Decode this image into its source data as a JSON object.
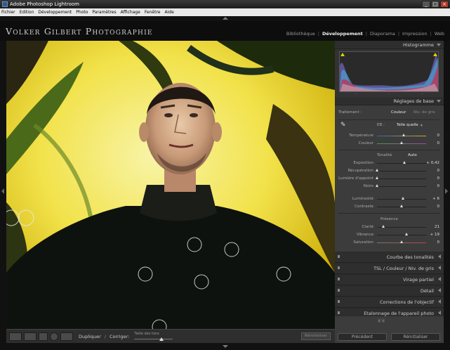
{
  "window": {
    "title": "Adobe Photoshop Lightroom"
  },
  "menu": [
    "Fichier",
    "Edition",
    "Développement",
    "Photo",
    "Paramètres",
    "Affichage",
    "Fenêtre",
    "Aide"
  ],
  "identity_plate": "Volker Gilbert Photographie",
  "modules": [
    {
      "label": "Bibliothèque",
      "active": false
    },
    {
      "label": "Développement",
      "active": true
    },
    {
      "label": "Diaporama",
      "active": false
    },
    {
      "label": "Impression",
      "active": false
    },
    {
      "label": "Web",
      "active": false
    }
  ],
  "toolbar": {
    "dupliquer": "Dupliquer",
    "separator": "/",
    "corriger": "Corriger:",
    "brush_label": "Taille des tons",
    "reset": "Réinitialiser"
  },
  "panels": {
    "histogram": "Histogramme",
    "basic": {
      "title": "Réglages de base",
      "treatment_label": "Traitement :",
      "treatment_options": [
        "Couleur",
        "Niv. de gris"
      ],
      "wb_label": "EB :",
      "wb_value": "Telle quelle",
      "sliders_wb": [
        {
          "label": "Température",
          "position": 0.55,
          "value": "0"
        },
        {
          "label": "Couleur",
          "position": 0.5,
          "value": "0"
        }
      ],
      "tone_title": "Tonalité",
      "tone_auto": "Auto",
      "sliders_tone": [
        {
          "label": "Exposition",
          "position": 0.56,
          "value": "+ 0,42"
        },
        {
          "label": "Récupération",
          "position": 0.0,
          "value": "0"
        },
        {
          "label": "Lumière d'appoint",
          "position": 0.0,
          "value": "0"
        },
        {
          "label": "Noirs",
          "position": 0.0,
          "value": "0"
        }
      ],
      "sliders_tone2": [
        {
          "label": "Luminosité",
          "position": 0.54,
          "value": "+ 6"
        },
        {
          "label": "Contraste",
          "position": 0.5,
          "value": "0"
        }
      ],
      "presence_title": "Présence",
      "sliders_presence": [
        {
          "label": "Clarté",
          "position": 0.13,
          "value": "21"
        },
        {
          "label": "Vibrance",
          "position": 0.6,
          "value": "+ 19"
        },
        {
          "label": "Saturation",
          "position": 0.5,
          "value": "0"
        }
      ]
    },
    "collapsed": [
      "Courbe des tonalités",
      "TSL / Couleur / Niv. de gris",
      "Virage partiel",
      "Détail",
      "Corrections de l'objectif",
      "Etalonnage de l'appareil photo"
    ],
    "footer": {
      "previous": "Précédent",
      "reset": "Réinitialiser"
    }
  },
  "colors": {
    "accent": "#e6e6e6",
    "panel_bg": "#3c3c3c",
    "background": "#0d0d0d"
  }
}
